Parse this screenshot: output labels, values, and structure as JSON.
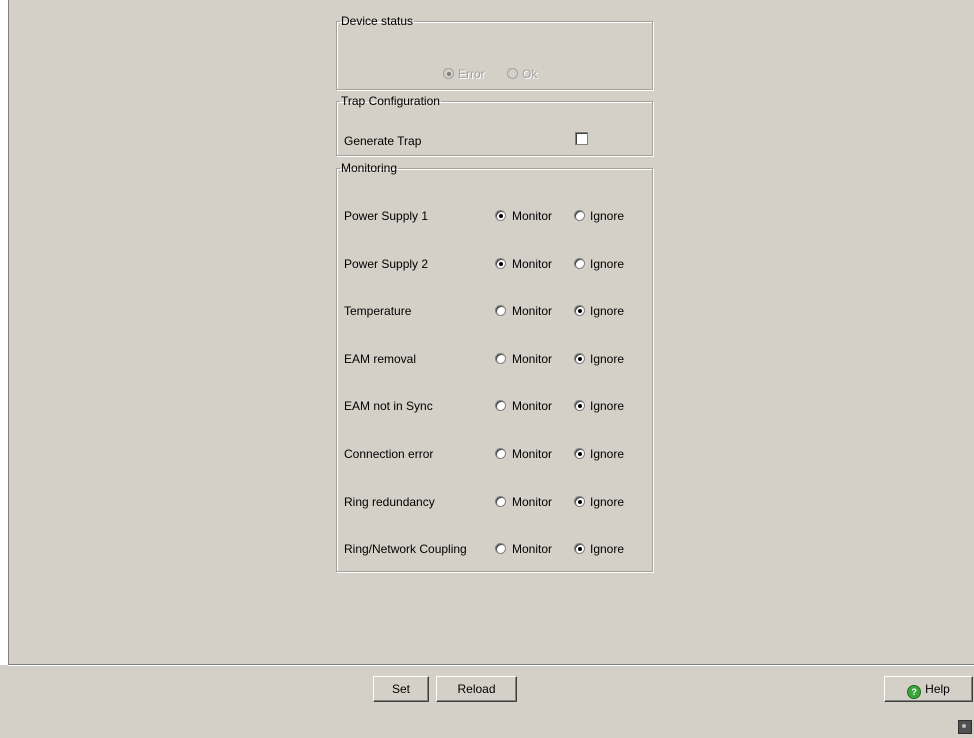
{
  "device_status": {
    "legend": "Device status",
    "options": [
      {
        "label": "Error",
        "selected": true,
        "enabled": false
      },
      {
        "label": "Ok",
        "selected": false,
        "enabled": false
      }
    ]
  },
  "trap_configuration": {
    "legend": "Trap Configuration",
    "generate_trap_label": "Generate Trap",
    "generate_trap_checked": false
  },
  "monitoring": {
    "legend": "Monitoring",
    "monitor_label": "Monitor",
    "ignore_label": "Ignore",
    "rows": [
      {
        "label": "Power Supply 1",
        "selected": "Monitor"
      },
      {
        "label": "Power Supply 2",
        "selected": "Monitor"
      },
      {
        "label": "Temperature",
        "selected": "Ignore"
      },
      {
        "label": "EAM removal",
        "selected": "Ignore"
      },
      {
        "label": "EAM not in Sync",
        "selected": "Ignore"
      },
      {
        "label": "Connection error",
        "selected": "Ignore"
      },
      {
        "label": "Ring redundancy",
        "selected": "Ignore"
      },
      {
        "label": "Ring/Network Coupling",
        "selected": "Ignore"
      }
    ]
  },
  "buttons": {
    "set": "Set",
    "reload": "Reload",
    "help": "Help"
  },
  "icons": {
    "help": "help-icon",
    "status": "status-indicator-icon"
  }
}
